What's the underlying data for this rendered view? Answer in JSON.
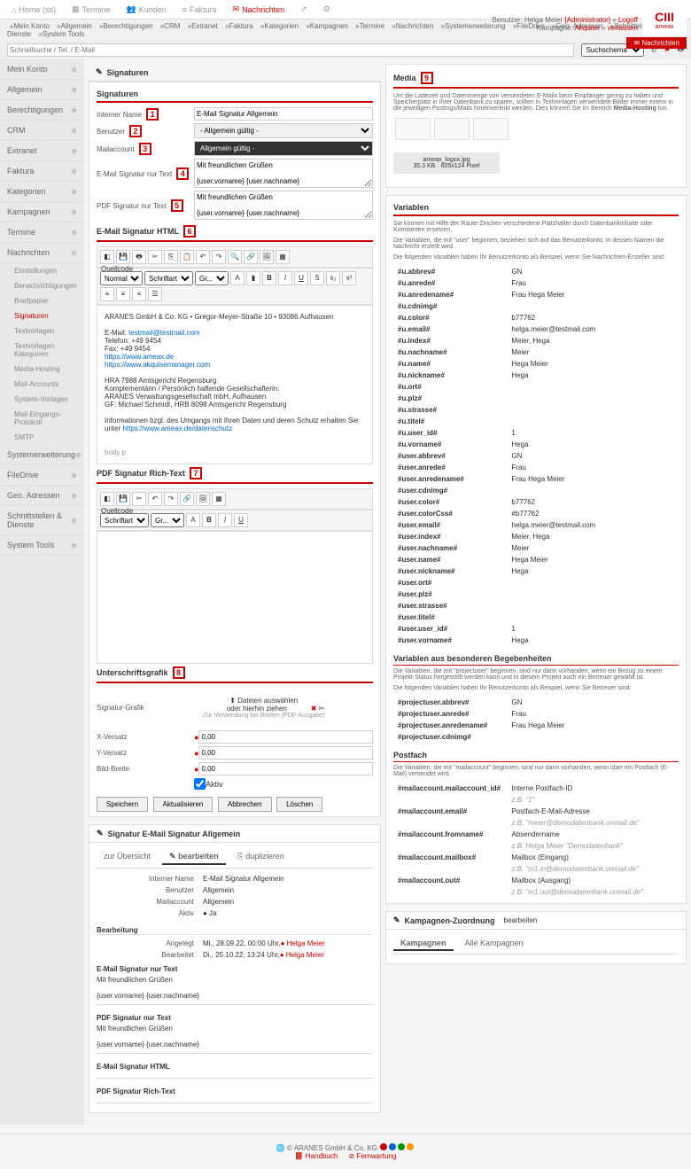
{
  "top_tabs": [
    "Home (ss)",
    "Termine",
    "Kunden",
    "Faktura",
    "Nachrichten"
  ],
  "breadcrumb": [
    "Mein Konto",
    "Allgemein",
    "Berechtigungen",
    "CRM",
    "Extranet",
    "Faktura",
    "Kategorien",
    "Kampagnen",
    "Termine",
    "Nachrichten",
    "Systemerweiterung",
    "FileDrive",
    "Geo. Adressen",
    "Schnittstellen & Dienste",
    "System Tools"
  ],
  "quickpath": "Schnellsuche / Tel. / E-Mail",
  "searchscheme": "Suchschema",
  "user": {
    "label": "Benutzer:",
    "name": "Helga Meier",
    "role": "[Administrator]",
    "logout": "Logoff",
    "campaign": "Kampagne:",
    "camp_name": "Akquise",
    "close": "verlassen"
  },
  "logo": {
    "main": "CIII",
    "sub": "ameax"
  },
  "nachrichten_btn": "Nachrichten",
  "sidebar": {
    "items": [
      "Mein Konto",
      "Allgemein",
      "Berechtigungen",
      "CRM",
      "Extranet",
      "Faktura",
      "Kategorien",
      "Kampagnen",
      "Termine",
      "Nachrichten"
    ],
    "subs": [
      "Einstellungen",
      "Benachrichtigungen",
      "Briefpapier",
      "Signaturen",
      "Textvorlagen",
      "Textvorlagen Kategorien",
      "Media-Hosting",
      "Mail-Accounts",
      "System-Vorlagen",
      "Mail-Eingangs-Protokoll",
      "SMTP"
    ],
    "items2": [
      "Systemerweiterung",
      "FileDrive",
      "Geo. Adressen",
      "Schnittstellen & Dienste",
      "System Tools"
    ]
  },
  "page_title": "Signaturen",
  "signatures": {
    "title": "Signaturen",
    "fields": {
      "interner_name": {
        "label": "Interner Name",
        "value": "E-Mail Signatur Allgemein"
      },
      "benutzer": {
        "label": "Benutzer",
        "value": "- Allgemein gültig -"
      },
      "mailaccount": {
        "label": "Mailaccount",
        "value": "Allgemein gültig -"
      },
      "text_only": {
        "label": "E-Mail Signatur nur Text",
        "value": "Mit freundlichen Grüßen\n\n{user.vorname} {user.nachname}"
      },
      "pdf_text": {
        "label": "PDF Signatur nur Text",
        "value": "Mit freundlichen Grüßen\n\n{user.vorname} {user.nachname}"
      },
      "html": {
        "label": "E-Mail Signatur HTML"
      },
      "rtf": {
        "label": "PDF Signatur Rich-Text"
      }
    },
    "rte_source": "Quellcode",
    "rte_font": "Schriftart",
    "rte_size": "Gr...",
    "rte_format": "Normal",
    "html_content": {
      "company": "ARANES GmbH & Co. KG • Gregor-Meyer-Straße 10 • 93086 Aufhausen",
      "email_lbl": "E-Mail:",
      "email": "testmail@testmail.com",
      "tel_lbl": "Telefon:",
      "tel": "+49 9454",
      "fax_lbl": "Fax:",
      "fax": "+49 9454",
      "web": "https://www.ameax.de",
      "web2": "https://www.akquisemanager.com",
      "hra": "HRA 7988 Amtsgericht Regensburg",
      "komp": "Komplementärin / Persönlich haftende Gesellschafterin:",
      "verwaltung": "ARANES Verwaltungsgesellschaft mbH, Aufhausen",
      "gf": "GF: Michael Schmidt, HRB 8098 Amtsgericht Regensburg",
      "datenschutz": "Informationen bzgl. des Umgangs mit Ihren Daten und deren Schutz erhalten Sie unter",
      "ds_link": "https://www.ameax.de/datenschutz",
      "body_path": "body p"
    },
    "unterschrift": {
      "title": "Unterschriftsgrafik",
      "grafik": "Signatur-Grafik",
      "upload": "Dateien auswählen\noder hierhin ziehen",
      "hint": "Zur Verwendung bei Briefen (PDF-Ausgabe)",
      "x": "X-Versatz",
      "y": "Y-Versatz",
      "breite": "Bild-Breite",
      "val": "0,00",
      "aktiv": "Aktiv"
    },
    "buttons": {
      "save": "Speichern",
      "update": "Aktualisieren",
      "cancel": "Abbrechen",
      "delete": "Löschen"
    }
  },
  "media": {
    "title": "Media",
    "desc": "Um die Ladezeit und Datenmenge von versendeten E-Mails beim Empfänger gering zu halten und Speicherplatz in Ihrer Datenbank zu sparen, sollten in Textvorlagen verwendete Bilder immer extern in die jeweiligen Postings/Mails hineinverlinkt werden. Dies können Sie im Bereich ",
    "link": "Media-Hosting",
    "desc2": " tun.",
    "file": {
      "name": "ameax_logox.jpg",
      "size": "35.3 KB · 605x124 Pixel"
    }
  },
  "variablen": {
    "title": "Variablen",
    "desc1": "Sie können mit Hilfe der Raute-Zeichen verschiedene Platzhalter durch Datenbankinhalte oder Konstanten ersetzen.",
    "desc2": "Die Variablen, die mit \"user\" beginnen, beziehen sich auf das Benutzerkonto, in dessen Namen die Nachricht erstellt wird.",
    "desc3": "Die folgenden Variablen haben Ihr Benutzerkonto als Beispiel, wenn Sie Nachrichten-Ersteller sind:",
    "rows": [
      [
        "#u.abbrev#",
        "GN"
      ],
      [
        "#u.anrede#",
        "Frau"
      ],
      [
        "#u.anredename#",
        "Frau Hega Meier"
      ],
      [
        "#u.cdnimg#",
        ""
      ],
      [
        "#u.color#",
        "b77762"
      ],
      [
        "#u.email#",
        "helga.meier@testmail.com"
      ],
      [
        "#u.index#",
        "Meier, Hega"
      ],
      [
        "#u.nachname#",
        "Meier"
      ],
      [
        "#u.name#",
        "Hega Meier"
      ],
      [
        "#u.nickname#",
        "Hega"
      ],
      [
        "#u.ort#",
        ""
      ],
      [
        "#u.plz#",
        ""
      ],
      [
        "#u.strasse#",
        ""
      ],
      [
        "#u.titel#",
        ""
      ],
      [
        "#u.user_id#",
        "1"
      ],
      [
        "#u.vorname#",
        "Hega"
      ],
      [
        "#user.abbrev#",
        "GN"
      ],
      [
        "#user.anrede#",
        "Frau"
      ],
      [
        "#user.anredename#",
        "Frau Hega Meier"
      ],
      [
        "#user.cdnimg#",
        ""
      ],
      [
        "#user.color#",
        "b77762"
      ],
      [
        "#user.colorCss#",
        "#b77762"
      ],
      [
        "#user.email#",
        "helga.meier@testmail.com"
      ],
      [
        "#user.index#",
        "Meier, Hega"
      ],
      [
        "#user.nachname#",
        "Meier"
      ],
      [
        "#user.name#",
        "Hega Meier"
      ],
      [
        "#user.nickname#",
        "Hega"
      ],
      [
        "#user.ort#",
        ""
      ],
      [
        "#user.plz#",
        ""
      ],
      [
        "#user.strasse#",
        ""
      ],
      [
        "#user.titel#",
        ""
      ],
      [
        "#user.user_id#",
        "1"
      ],
      [
        "#user.vorname#",
        "Hega"
      ]
    ],
    "besondere": {
      "title": "Variablen aus besonderen Begebenheiten",
      "desc1": "Die Variablen, die mit \"projectuser\" beginnen, sind nur dann vorhanden, wenn ein Bezug zu einem Projekt-Status hergestellt werden kann und in diesem Projekt auch ein Betreuer gewählt ist.",
      "desc2": "Die folgenden Variablen haben Ihr Benutzerkonto als Beispiel, wenn Sie Betreuer sind:",
      "rows": [
        [
          "#projectuser.abbrev#",
          "GN"
        ],
        [
          "#projectuser.anrede#",
          "Frau"
        ],
        [
          "#projectuser.anredename#",
          "Frau Hega Meier"
        ],
        [
          "#projectuser.cdnimg#",
          ""
        ]
      ]
    },
    "postfach": {
      "title": "Postfach",
      "desc": "Die Variablen, die mit \"mailaccount\" beginnen, sind nur dann vorhanden, wenn über ein Postfach (E-Mail) versendet wird.",
      "rows": [
        [
          "#mailaccount.mailaccount_id#",
          "Interne Postfach-ID",
          "z.B. \"1\""
        ],
        [
          "#mailaccount.email#",
          "Postfach-E-Mail-Adresse",
          "z.B. \"meier@demodatenbank.onmail.de\""
        ],
        [
          "#mailaccount.fromname#",
          "Absendername",
          "z.B. Helga Meier \"Demodatenbank\""
        ],
        [
          "#mailaccount.mailbox#",
          "Mailbox (Eingang)",
          "z.B. \"m1.in@demodatenbank.onmail.de\""
        ],
        [
          "#mailaccount.out#",
          "Mailbox (Ausgang)",
          "z.B. \"m1.out@demodatenbank.onmail.de\""
        ]
      ]
    }
  },
  "detail": {
    "title": "Signatur E-Mail Signatur Allgemein",
    "tabs": [
      "zur Übersicht",
      "bearbeiten",
      "duplizieren"
    ],
    "rows": [
      [
        "Interner Name",
        "E-Mail Signatur Allgemein"
      ],
      [
        "Benutzer",
        "Allgemein"
      ],
      [
        "Mailaccount",
        "Allgemein"
      ],
      [
        "Aktiv",
        "● Ja"
      ]
    ],
    "bearbeitung": "Bearbeitung",
    "angelegt": [
      "Angelegt",
      "Mi., 28.09.22, 00:00 Uhr,",
      "Helga Meier"
    ],
    "bearbeitet": [
      "Bearbeitet",
      "Di., 25.10.22, 13:24 Uhr,",
      "Helga Meier"
    ],
    "sections": [
      {
        "title": "E-Mail Signatur nur Text",
        "content": "Mit freundlichen Grüßen\n\n{user.vorname} {user.nachname}"
      },
      {
        "title": "PDF Signatur nur Text",
        "content": "Mit freundlichen Grüßen\n\n{user.vorname} {user.nachname}"
      },
      {
        "title": "E-Mail Signatur HTML",
        "content": ""
      },
      {
        "title": "PDF Signatur Rich-Text",
        "content": ""
      }
    ]
  },
  "kampagnen": {
    "title": "Kampagnen-Zuordnung",
    "edit": "bearbeiten",
    "tabs": [
      "Kampagnen",
      "Alle Kampagnen"
    ]
  },
  "footer": {
    "copyright": "© ARANES GmbH & Co. KG",
    "handbuch": "Handbuch",
    "fernwartung": "Fernwartung"
  }
}
